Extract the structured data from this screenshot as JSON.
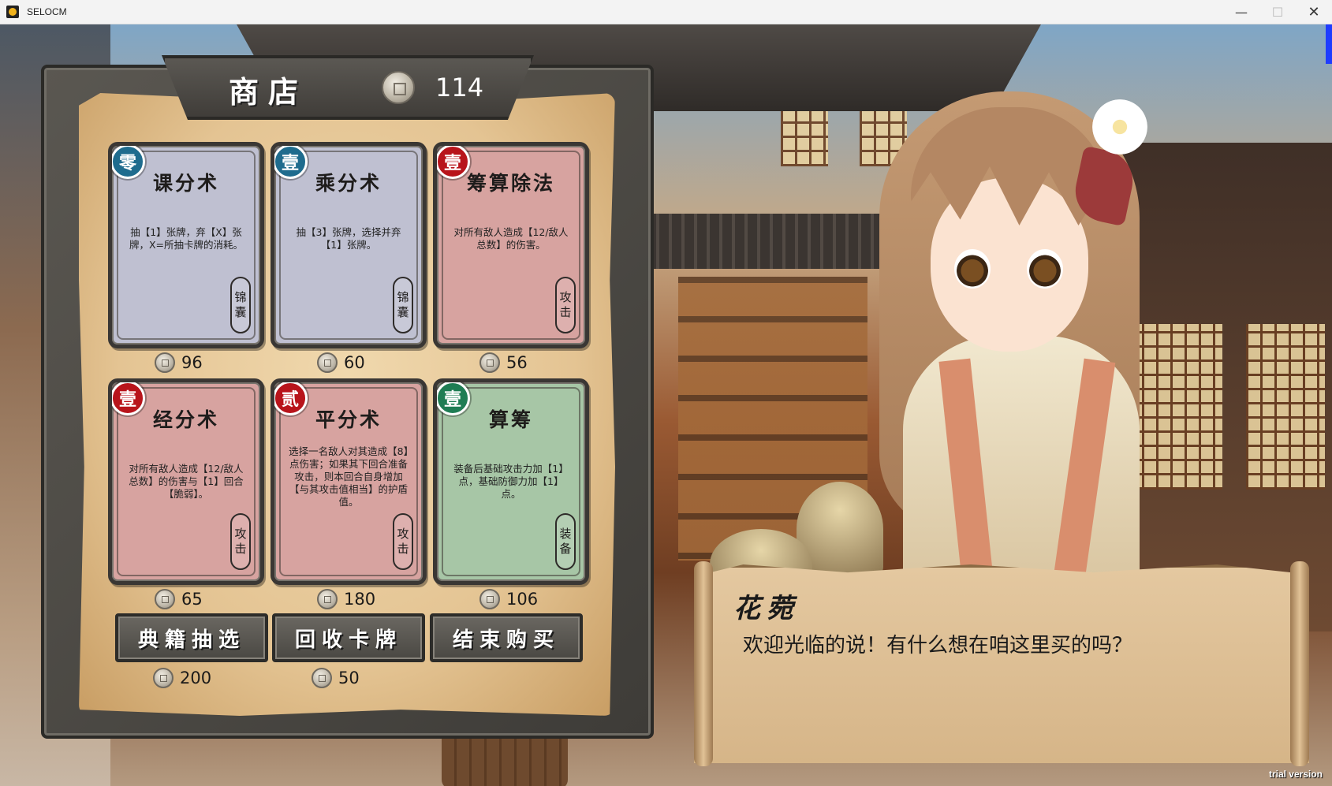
{
  "window": {
    "title": "SELOCM"
  },
  "shop": {
    "title": "商店",
    "gold": "114",
    "cards": [
      {
        "name": "课分术",
        "cost": "零",
        "cost_color": "#1f6c8e",
        "desc": "抽【1】张牌，弃【X】张牌，X=所抽卡牌的消耗。",
        "type": [
          "锦",
          "囊"
        ],
        "price": "96",
        "color": "#bfc0d1"
      },
      {
        "name": "乘分术",
        "cost": "壹",
        "cost_color": "#1f6c8e",
        "desc": "抽【3】张牌，选择并弃【1】张牌。",
        "type": [
          "锦",
          "囊"
        ],
        "price": "60",
        "color": "#bfc0d1"
      },
      {
        "name": "筹算除法",
        "cost": "壹",
        "cost_color": "#b8141b",
        "desc": "对所有敌人造成【12/敌人总数】的伤害。",
        "type": [
          "攻",
          "击"
        ],
        "price": "56",
        "color": "#d7a3a0"
      },
      {
        "name": "经分术",
        "cost": "壹",
        "cost_color": "#b8141b",
        "desc": "对所有敌人造成【12/敌人总数】的伤害与【1】回合【脆弱】。",
        "type": [
          "攻",
          "击"
        ],
        "price": "65",
        "color": "#d7a3a0"
      },
      {
        "name": "平分术",
        "cost": "贰",
        "cost_color": "#b8141b",
        "desc": "选择一名敌人对其造成【8】点伤害；如果其下回合准备攻击，则本回合自身增加【与其攻击值相当】的护盾值。",
        "type": [
          "攻",
          "击"
        ],
        "price": "180",
        "color": "#d7a3a0"
      },
      {
        "name": "算筹",
        "cost": "壹",
        "cost_color": "#1f7d54",
        "desc": "装备后基础攻击力加【1】点，基础防御力加【1】点。",
        "type": [
          "装",
          "备"
        ],
        "price": "106",
        "color": "#a7c6a6"
      }
    ],
    "buttons": {
      "draw": "典籍抽选",
      "draw_price": "200",
      "recycle": "回收卡牌",
      "recycle_price": "50",
      "end": "结束购买"
    }
  },
  "dialog": {
    "speaker": "花菀",
    "text": "欢迎光临的说！有什么想在咱这里买的吗？"
  },
  "watermark": "trial version"
}
